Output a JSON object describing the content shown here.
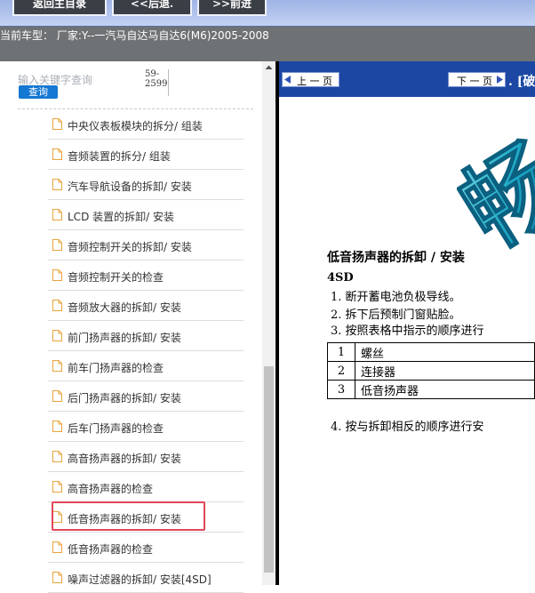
{
  "toolbar": {
    "home_label": "返回主目录",
    "back_label": "<<后退.",
    "forward_label": ">>前进"
  },
  "vehicle_info": "当前车型：  厂家:Y--一汽马自达马自达6(M6)2005-2008",
  "search": {
    "hint": "输入关键字查询",
    "button_label": "查询",
    "code": "59-2599"
  },
  "list": [
    {
      "label": "中央仪表板模块的拆分/ 组装",
      "selected": false
    },
    {
      "label": "音频装置的拆分/ 组装",
      "selected": false
    },
    {
      "label": "汽车导航设备的拆卸/ 安装",
      "selected": false
    },
    {
      "label": "LCD 装置的拆卸/ 安装",
      "selected": false
    },
    {
      "label": "音频控制开关的拆卸/ 安装",
      "selected": false
    },
    {
      "label": "音频控制开关的检查",
      "selected": false
    },
    {
      "label": "音频放大器的拆卸/ 安装",
      "selected": false
    },
    {
      "label": "前门扬声器的拆卸/ 安装",
      "selected": false
    },
    {
      "label": "前车门扬声器的检查",
      "selected": false
    },
    {
      "label": "后门扬声器的拆卸/ 安装",
      "selected": false
    },
    {
      "label": "后车门扬声器的检查",
      "selected": false
    },
    {
      "label": "高音扬声器的拆卸/ 安装",
      "selected": false
    },
    {
      "label": "高音扬声器的检查",
      "selected": false
    },
    {
      "label": "低音扬声器的拆卸/ 安装",
      "selected": true
    },
    {
      "label": "低音扬声器的检查",
      "selected": false
    },
    {
      "label": "噪声过滤器的拆卸/ 安装[4SD]",
      "selected": false
    }
  ],
  "doc": {
    "prev_label": "上 一 页",
    "next_label": "下 一 页",
    "next_tail": ". [破",
    "logo_text": "畅",
    "title": "低音扬声器的拆卸 / 安装",
    "subtitle": "4SD",
    "steps": [
      "1.  断开蓄电池负极导线。",
      "2.  拆下后预制门窗贴脸。",
      "3.  按照表格中指示的顺序进行",
      "4.  按与拆卸相反的顺序进行安"
    ],
    "parts": [
      {
        "no": "1",
        "name": "螺丝"
      },
      {
        "no": "2",
        "name": "连接器"
      },
      {
        "no": "3",
        "name": "低音扬声器"
      }
    ]
  },
  "colors": {
    "selected_border": "#e0485a",
    "nav_blue": "#1c48a3",
    "search_blue": "#1477d2"
  }
}
